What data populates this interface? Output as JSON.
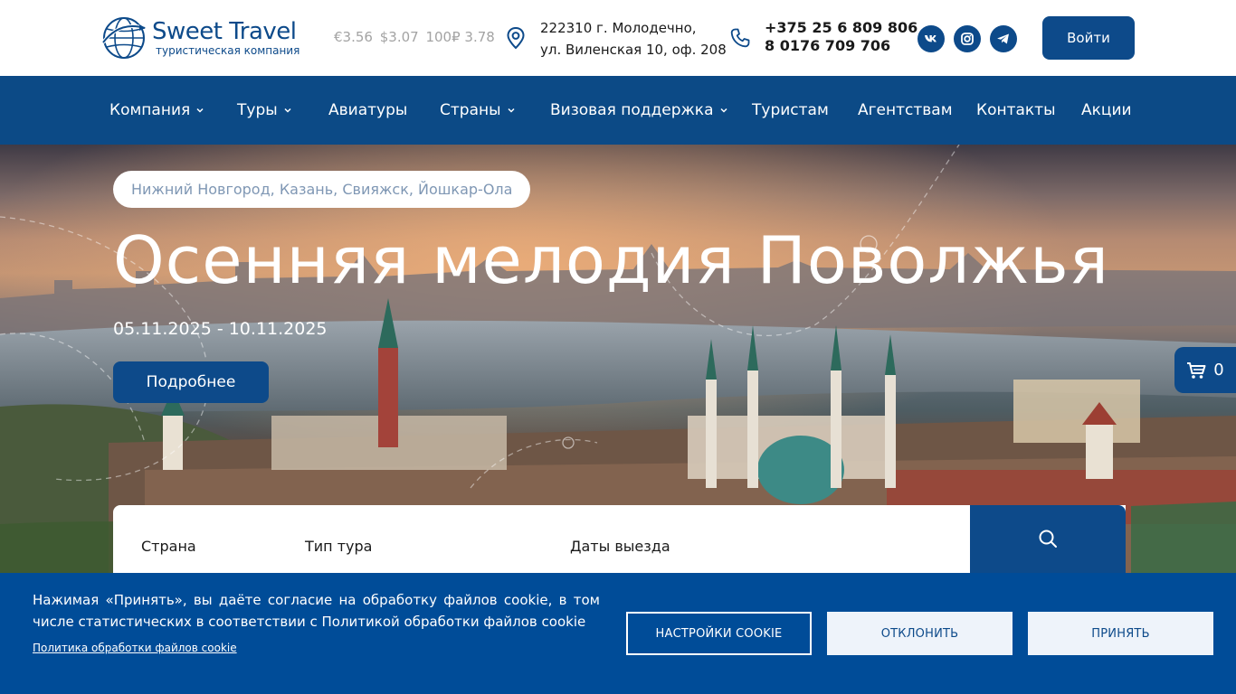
{
  "header": {
    "logo": {
      "name": "Sweet Travel",
      "subtitle": "туристическая компания"
    },
    "rates": [
      "€3.56",
      "$3.07",
      "100₽ 3.78"
    ],
    "address": {
      "line1": "222310 г. Молодечно,",
      "line2": "ул. Виленская 10, оф. 208"
    },
    "phones": [
      "+375 25 6 809 806",
      "8 0176 709 706"
    ],
    "social": [
      "vk-icon",
      "instagram-icon",
      "telegram-icon"
    ],
    "login_label": "Войти"
  },
  "nav": {
    "items": [
      {
        "label": "Компания",
        "dropdown": true
      },
      {
        "label": "Туры",
        "dropdown": true
      },
      {
        "label": "Авиатуры",
        "dropdown": false
      },
      {
        "label": "Страны",
        "dropdown": true
      },
      {
        "label": "Визовая поддержка",
        "dropdown": true
      },
      {
        "label": "Туристам",
        "dropdown": false
      },
      {
        "label": "Агентствам",
        "dropdown": false
      },
      {
        "label": "Контакты",
        "dropdown": false
      },
      {
        "label": "Акции",
        "dropdown": false
      }
    ]
  },
  "hero": {
    "route": "Нижний Новгород, Казань, Свияжск, Йошкар-Ола",
    "title": "Осенняя мелодия Поволжья",
    "dates": "05.11.2025 - 10.11.2025",
    "more_label": "Подробнее"
  },
  "cart": {
    "count": "0"
  },
  "search": {
    "country_label": "Страна",
    "tour_type_label": "Тип тура",
    "dates_label": "Даты выезда"
  },
  "cookie": {
    "text": "Нажимая «Принять», вы даёте согласие на обработку файлов cookie, в том числе статистических в соответствии с Политикой обработки файлов cookie",
    "policy_link": "Политика обработки файлов cookie",
    "settings_label": "НАСТРОЙКИ COOKIE",
    "decline_label": "ОТКЛОНИТЬ",
    "accept_label": "ПРИНЯТЬ"
  },
  "colors": {
    "brand": "#0d4a8a",
    "nav_bg": "#0c4a86",
    "cookie_bg": "#004c98",
    "route_text": "#7f97b4"
  }
}
